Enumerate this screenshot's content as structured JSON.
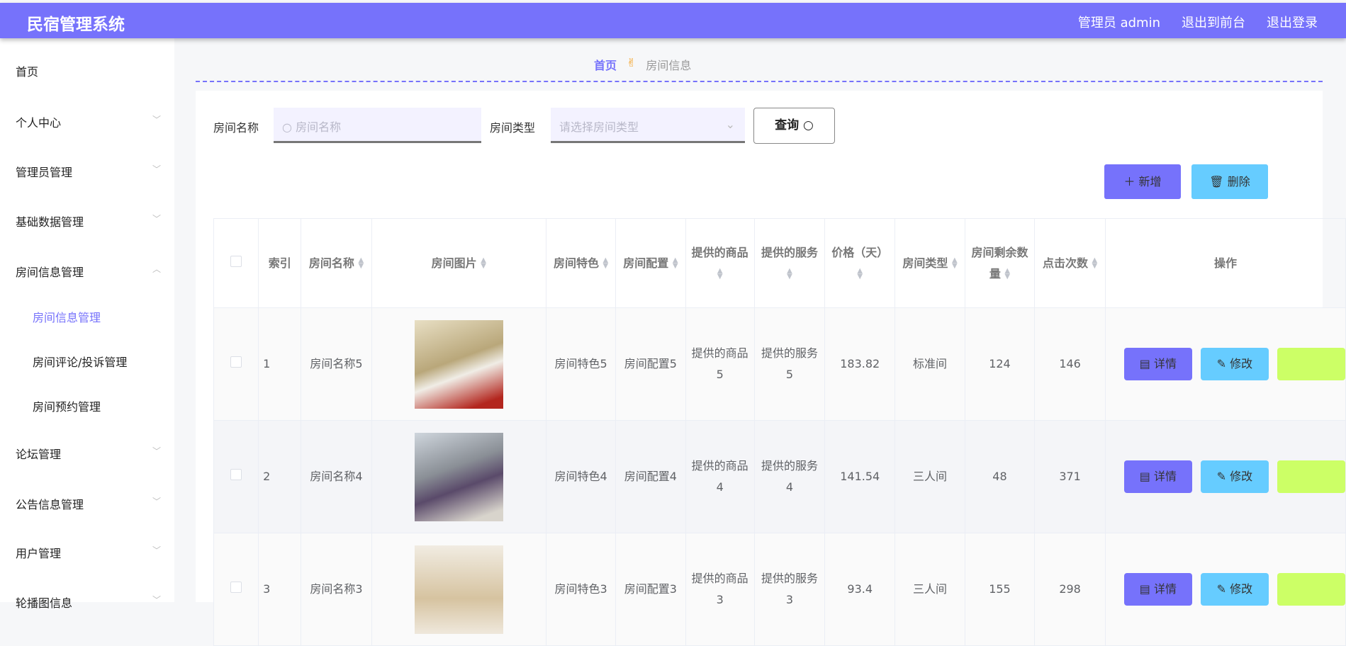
{
  "header": {
    "title": "民宿管理系统",
    "user": "管理员 admin",
    "front": "退出到前台",
    "logout": "退出登录"
  },
  "sidebar": {
    "items": [
      {
        "label": "首页",
        "chev": false
      },
      {
        "label": "个人中心",
        "chev": true
      },
      {
        "label": "管理员管理",
        "chev": true
      },
      {
        "label": "基础数据管理",
        "chev": true
      },
      {
        "label": "房间信息管理",
        "chev": true,
        "open": true
      },
      {
        "label": "房间信息管理",
        "sub": true,
        "active": true
      },
      {
        "label": "房间评论/投诉管理",
        "sub": true
      },
      {
        "label": "房间预约管理",
        "sub": true
      },
      {
        "label": "论坛管理",
        "chev": true
      },
      {
        "label": "公告信息管理",
        "chev": true
      },
      {
        "label": "用户管理",
        "chev": true
      },
      {
        "label": "轮播图信息",
        "chev": true
      }
    ]
  },
  "breadcrumb": {
    "home": "首页",
    "current": "房间信息"
  },
  "search": {
    "name_label": "房间名称",
    "name_placeholder": "房间名称",
    "type_label": "房间类型",
    "type_placeholder": "请选择房间类型",
    "query": "查询"
  },
  "actions": {
    "add": "新增",
    "delete": "删除"
  },
  "colors": {
    "primary": "#7672fb",
    "info": "#66ccff",
    "warn": "#ccff66"
  },
  "table": {
    "headers": [
      "",
      "索引",
      "房间名称",
      "房间图片",
      "房间特色",
      "房间配置",
      "提供的商品",
      "提供的服务",
      "价格（天）",
      "房间类型",
      "房间剩余数量",
      "点击次数",
      "操作"
    ],
    "rows": [
      {
        "index": "1",
        "name": "房间名称5",
        "feature": "房间特色5",
        "config": "房间配置5",
        "goods": "提供的商品5",
        "service": "提供的服务5",
        "price": "183.82",
        "type": "标准间",
        "remain": "124",
        "clicks": "146"
      },
      {
        "index": "2",
        "name": "房间名称4",
        "feature": "房间特色4",
        "config": "房间配置4",
        "goods": "提供的商品4",
        "service": "提供的服务4",
        "price": "141.54",
        "type": "三人间",
        "remain": "48",
        "clicks": "371"
      },
      {
        "index": "3",
        "name": "房间名称3",
        "feature": "房间特色3",
        "config": "房间配置3",
        "goods": "提供的商品3",
        "service": "提供的服务3",
        "price": "93.4",
        "type": "三人间",
        "remain": "155",
        "clicks": "298"
      }
    ],
    "row_actions": {
      "detail": "详情",
      "edit": "修改"
    }
  }
}
